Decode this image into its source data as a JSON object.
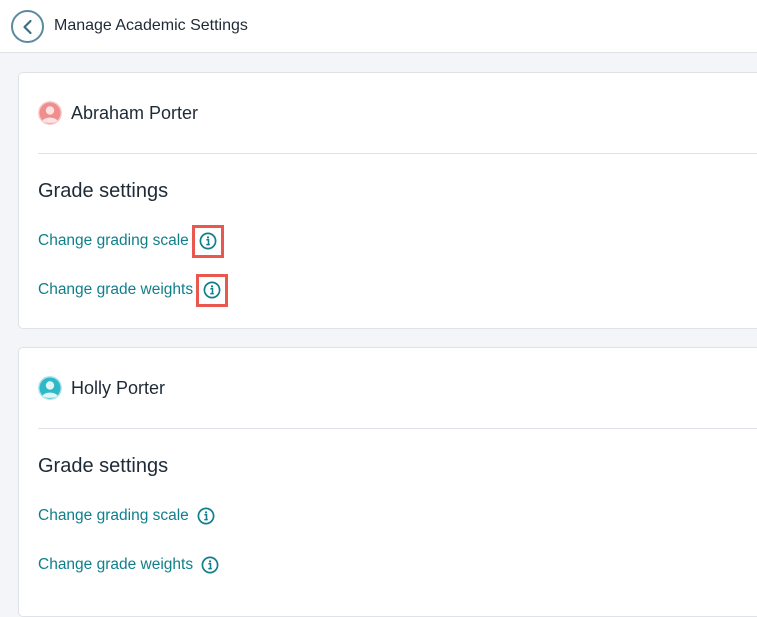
{
  "header": {
    "title": "Manage Academic Settings",
    "back_icon": "chevron-left-icon"
  },
  "colors": {
    "link": "#0f7f8a",
    "highlight": "#e8584e",
    "avatar_abraham": "#f08d8d",
    "avatar_holly": "#2fb8c8"
  },
  "students": [
    {
      "name": "Abraham Porter",
      "avatar_icon": "user-avatar-icon",
      "section_title": "Grade settings",
      "links": [
        {
          "label": "Change grading scale",
          "icon": "info-icon",
          "highlighted": true
        },
        {
          "label": "Change grade weights",
          "icon": "info-icon",
          "highlighted": true
        }
      ]
    },
    {
      "name": "Holly Porter",
      "avatar_icon": "user-avatar-icon",
      "section_title": "Grade settings",
      "links": [
        {
          "label": "Change grading scale",
          "icon": "info-icon",
          "highlighted": false
        },
        {
          "label": "Change grade weights",
          "icon": "info-icon",
          "highlighted": false
        }
      ]
    }
  ]
}
